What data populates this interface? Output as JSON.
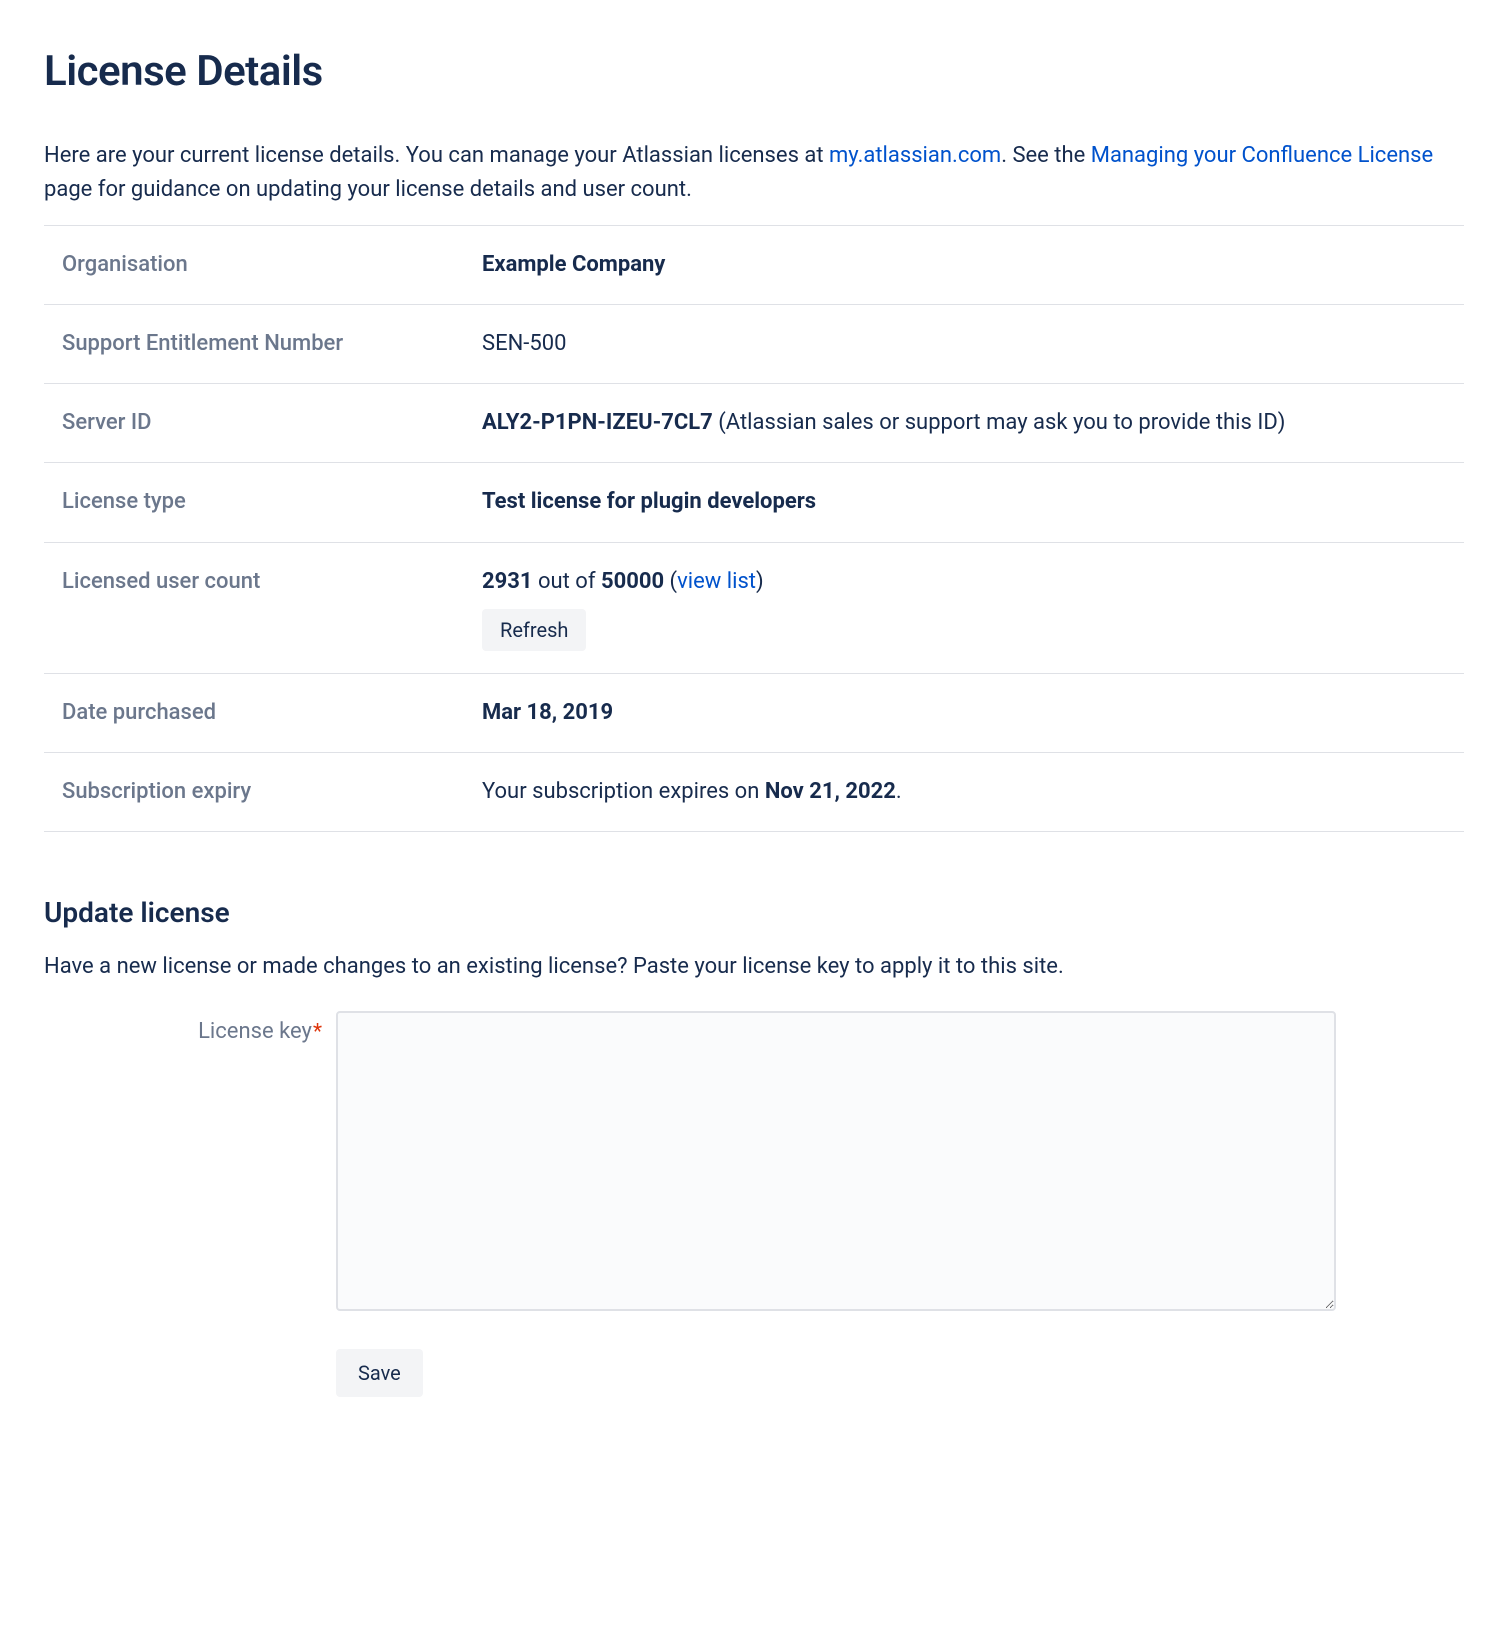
{
  "page": {
    "title": "License Details",
    "intro_prefix": "Here are your current license details. You can manage your Atlassian licenses at ",
    "intro_link1": "my.atlassian.com",
    "intro_mid": ". See the ",
    "intro_link2": "Managing your Confluence License",
    "intro_suffix": " page for guidance on updating your license details and user count."
  },
  "details": {
    "org_label": "Organisation",
    "org_value": "Example Company",
    "sen_label": "Support Entitlement Number",
    "sen_value": "SEN-500",
    "server_id_label": "Server ID",
    "server_id_value": "ALY2-P1PN-IZEU-7CL7",
    "server_id_note": " (Atlassian sales or support may ask you to provide this ID)",
    "license_type_label": "License type",
    "license_type_value": "Test license for plugin developers",
    "user_count_label": "Licensed user count",
    "user_count_current": "2931",
    "user_count_mid": " out of ",
    "user_count_max": "50000",
    "user_count_open_paren": " (",
    "user_count_view_list": "view list",
    "user_count_close_paren": ")",
    "refresh_label": "Refresh",
    "date_purchased_label": "Date purchased",
    "date_purchased_value": "Mar 18, 2019",
    "expiry_label": "Subscription expiry",
    "expiry_prefix": "Your subscription expires on ",
    "expiry_date": "Nov 21, 2022",
    "expiry_suffix": "."
  },
  "update": {
    "title": "Update license",
    "desc": "Have a new license or made changes to an existing license? Paste your license key to apply it to this site.",
    "key_label": "License key",
    "save_label": "Save"
  }
}
